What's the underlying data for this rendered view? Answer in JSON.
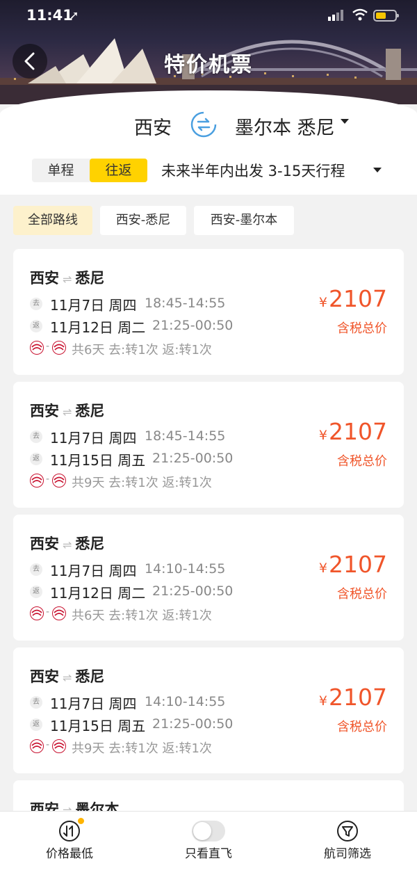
{
  "status_bar": {
    "time": "11:41"
  },
  "header": {
    "title": "特价机票"
  },
  "search": {
    "from_city": "西安",
    "to_city": "墨尔本 悉尼",
    "trip_types": [
      "单程",
      "往返"
    ],
    "selected_trip_type": "往返",
    "date_range": "未来半年内出发 3-15天行程"
  },
  "route_filters": [
    {
      "label": "全部路线",
      "active": true
    },
    {
      "label": "西安-悉尼",
      "active": false
    },
    {
      "label": "西安-墨尔本",
      "active": false
    }
  ],
  "flights": [
    {
      "from": "西安",
      "to": "悉尼",
      "outbound": {
        "tag": "去",
        "date": "11月7日 周四",
        "time": "18:45-14:55"
      },
      "return": {
        "tag": "返",
        "date": "11月12日 周二",
        "time": "21:25-00:50"
      },
      "summary": "共6天 去:转1次 返:转1次",
      "currency": "¥",
      "price": "2107",
      "price_label": "含税总价"
    },
    {
      "from": "西安",
      "to": "悉尼",
      "outbound": {
        "tag": "去",
        "date": "11月7日 周四",
        "time": "18:45-14:55"
      },
      "return": {
        "tag": "返",
        "date": "11月15日 周五",
        "time": "21:25-00:50"
      },
      "summary": "共9天 去:转1次 返:转1次",
      "currency": "¥",
      "price": "2107",
      "price_label": "含税总价"
    },
    {
      "from": "西安",
      "to": "悉尼",
      "outbound": {
        "tag": "去",
        "date": "11月7日 周四",
        "time": "14:10-14:55"
      },
      "return": {
        "tag": "返",
        "date": "11月12日 周二",
        "time": "21:25-00:50"
      },
      "summary": "共6天 去:转1次 返:转1次",
      "currency": "¥",
      "price": "2107",
      "price_label": "含税总价"
    },
    {
      "from": "西安",
      "to": "悉尼",
      "outbound": {
        "tag": "去",
        "date": "11月7日 周四",
        "time": "14:10-14:55"
      },
      "return": {
        "tag": "返",
        "date": "11月15日 周五",
        "time": "21:25-00:50"
      },
      "summary": "共9天 去:转1次 返:转1次",
      "currency": "¥",
      "price": "2107",
      "price_label": "含税总价"
    },
    {
      "from": "西安",
      "to": "墨尔本"
    }
  ],
  "tabbar": {
    "price_sort": "价格最低",
    "direct_only": "只看直飞",
    "airline_filter": "航司筛选"
  },
  "colors": {
    "accent_yellow": "#ffd200",
    "price_orange": "#f0552a",
    "airline_red": "#c8102e"
  }
}
